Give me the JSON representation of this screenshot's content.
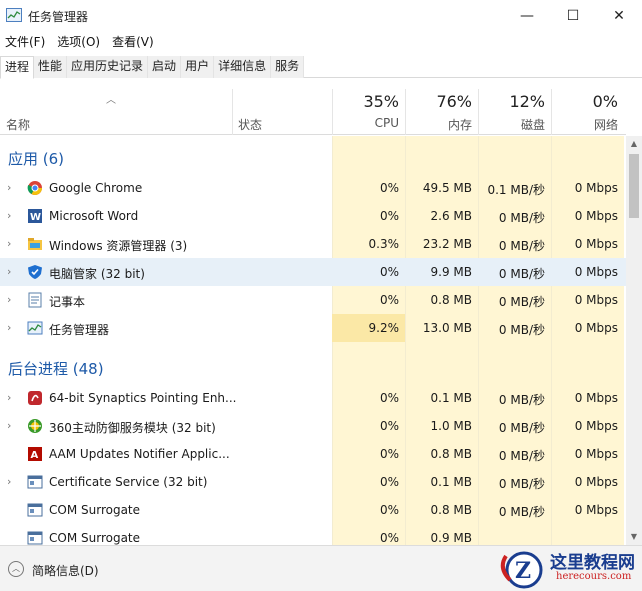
{
  "window": {
    "title": "任务管理器",
    "minimize": "—",
    "maximize": "☐",
    "close": "✕"
  },
  "menu": [
    "文件(F)",
    "选项(O)",
    "查看(V)"
  ],
  "tabs": [
    "进程",
    "性能",
    "应用历史记录",
    "启动",
    "用户",
    "详细信息",
    "服务"
  ],
  "active_tab": "进程",
  "columns": {
    "name": "名称",
    "status": "状态",
    "cpu": {
      "percent": "35%",
      "label": "CPU"
    },
    "memory": {
      "percent": "76%",
      "label": "内存"
    },
    "disk": {
      "percent": "12%",
      "label": "磁盘"
    },
    "network": {
      "percent": "0%",
      "label": "网络"
    }
  },
  "groups": [
    {
      "title": "应用 (6)",
      "rows": [
        {
          "name": "Google Chrome",
          "icon": "chrome-icon",
          "cpu": "0%",
          "mem": "49.5 MB",
          "disk": "0.1 MB/秒",
          "net": "0 Mbps",
          "expandable": true
        },
        {
          "name": "Microsoft Word",
          "icon": "word-icon",
          "cpu": "0%",
          "mem": "2.6 MB",
          "disk": "0 MB/秒",
          "net": "0 Mbps",
          "expandable": true
        },
        {
          "name": "Windows 资源管理器 (3)",
          "icon": "explorer-icon",
          "cpu": "0.3%",
          "mem": "23.2 MB",
          "disk": "0 MB/秒",
          "net": "0 Mbps",
          "expandable": true
        },
        {
          "name": "电脑管家 (32 bit)",
          "icon": "shield-icon",
          "cpu": "0%",
          "mem": "9.9 MB",
          "disk": "0 MB/秒",
          "net": "0 Mbps",
          "expandable": true,
          "selected": true
        },
        {
          "name": "记事本",
          "icon": "notepad-icon",
          "cpu": "0%",
          "mem": "0.8 MB",
          "disk": "0 MB/秒",
          "net": "0 Mbps",
          "expandable": true
        },
        {
          "name": "任务管理器",
          "icon": "task-manager-icon",
          "cpu": "9.2%",
          "mem": "13.0 MB",
          "disk": "0 MB/秒",
          "net": "0 Mbps",
          "expandable": true
        }
      ]
    },
    {
      "title": "后台进程 (48)",
      "rows": [
        {
          "name": "64-bit Synaptics Pointing Enh...",
          "icon": "synaptics-icon",
          "cpu": "0%",
          "mem": "0.1 MB",
          "disk": "0 MB/秒",
          "net": "0 Mbps",
          "expandable": true
        },
        {
          "name": "360主动防御服务模块 (32 bit)",
          "icon": "360-icon",
          "cpu": "0%",
          "mem": "1.0 MB",
          "disk": "0 MB/秒",
          "net": "0 Mbps",
          "expandable": true
        },
        {
          "name": "AAM Updates Notifier Applic...",
          "icon": "adobe-icon",
          "cpu": "0%",
          "mem": "0.8 MB",
          "disk": "0 MB/秒",
          "net": "0 Mbps",
          "expandable": false
        },
        {
          "name": "Certificate Service (32 bit)",
          "icon": "service-icon",
          "cpu": "0%",
          "mem": "0.1 MB",
          "disk": "0 MB/秒",
          "net": "0 Mbps",
          "expandable": true
        },
        {
          "name": "COM Surrogate",
          "icon": "service-icon",
          "cpu": "0%",
          "mem": "0.8 MB",
          "disk": "0 MB/秒",
          "net": "0 Mbps",
          "expandable": false
        },
        {
          "name": "COM Surrogate",
          "icon": "service-icon",
          "cpu": "0%",
          "mem": "0.9 MB",
          "disk": "",
          "net": "",
          "expandable": false
        }
      ]
    }
  ],
  "footer": {
    "fewer_details": "简略信息(D)"
  },
  "watermark": {
    "line1": "这里教程网",
    "line2": "herecours.com"
  },
  "colors": {
    "group_title": "#1e5aa8",
    "heat_light": "#fff6d3",
    "heat_medium": "#fbe8a6",
    "selected_row": "#e7f0f8"
  }
}
